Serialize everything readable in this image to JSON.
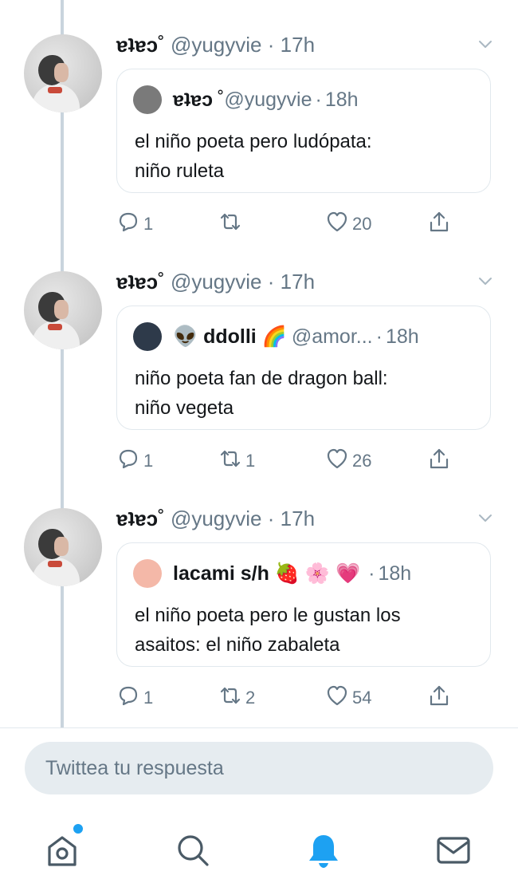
{
  "tweets": [
    {
      "name": "ɐʇɐɔ",
      "mark": "˚",
      "handle": "@yugyvie",
      "dot": "·",
      "time": "17h",
      "quote": {
        "avatar_color": "#7a7a7a",
        "name": "ɐʇɐɔ",
        "mark": "˚",
        "handle": "@yugyvie",
        "time": "18h",
        "text": "el niño poeta pero ludópata:\nniño ruleta"
      },
      "reply_count": "1",
      "retweet_count": "",
      "like_count": "20"
    },
    {
      "name": "ɐʇɐɔ",
      "mark": "˚",
      "handle": "@yugyvie",
      "dot": "·",
      "time": "17h",
      "quote": {
        "avatar_color": "#2e3a4a",
        "name": "👽 ddolli 🌈",
        "mark": "",
        "handle": "@amor...",
        "time": "18h",
        "text": "niño poeta fan de dragon ball:\nniño vegeta"
      },
      "reply_count": "1",
      "retweet_count": "1",
      "like_count": "26"
    },
    {
      "name": "ɐʇɐɔ",
      "mark": "˚",
      "handle": "@yugyvie",
      "dot": "·",
      "time": "17h",
      "quote": {
        "avatar_color": "#f4b8a8",
        "name": "lacami s/h 🍓 🌸 💗",
        "mark": "",
        "handle": "",
        "time": "18h",
        "text": "el niño poeta pero le gustan los\nasaitos: el niño zabaleta"
      },
      "reply_count": "1",
      "retweet_count": "2",
      "like_count": "54"
    }
  ],
  "reply_box": {
    "placeholder": "Twittea tu respuesta"
  },
  "tabbar": {
    "items": [
      "home-icon",
      "search-icon",
      "notifications-icon",
      "messages-icon"
    ],
    "active": "notifications-icon"
  },
  "colors": {
    "accent": "#1da1f2",
    "muted": "#657786",
    "border": "#e1e8ed"
  }
}
